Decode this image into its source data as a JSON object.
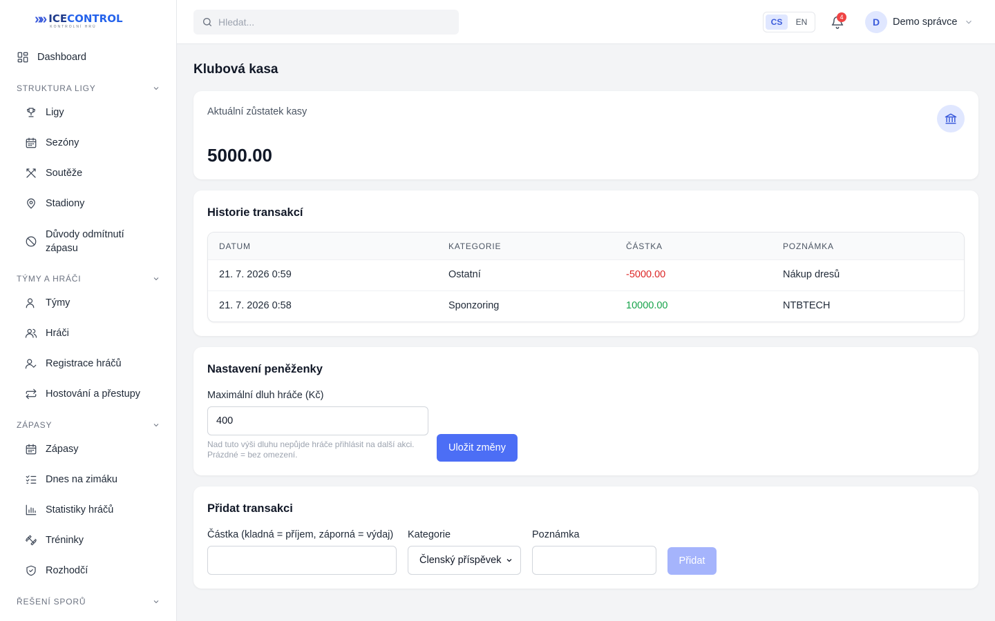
{
  "brand": {
    "logo_main_1": "ICE",
    "logo_main_2": "CONTROL",
    "logo_sub": "KONTROLNÍ HRÚ"
  },
  "sidebar": {
    "dashboard": "Dashboard",
    "sections": [
      {
        "title": "STRUKTURA LIGY",
        "items": [
          "Ligy",
          "Sezóny",
          "Soutěže",
          "Stadiony",
          "Důvody odmítnutí zápasu"
        ]
      },
      {
        "title": "TÝMY A HRÁČI",
        "items": [
          "Týmy",
          "Hráči",
          "Registrace hráčů",
          "Hostování a přestupy"
        ]
      },
      {
        "title": "ZÁPASY",
        "items": [
          "Zápasy",
          "Dnes na zimáku",
          "Statistiky hráčů",
          "Tréninky",
          "Rozhodčí"
        ]
      },
      {
        "title": "ŘEŠENÍ SPORŮ",
        "items": []
      }
    ]
  },
  "header": {
    "search_placeholder": "Hledat...",
    "languages": [
      "CS",
      "EN"
    ],
    "active_language": "CS",
    "notification_count": "4",
    "user_initial": "D",
    "user_name": "Demo správce"
  },
  "page": {
    "title": "Klubová kasa",
    "balance_label": "Aktuální zůstatek kasy",
    "balance_value": "5000.00",
    "history": {
      "title": "Historie transakcí",
      "columns": [
        "DATUM",
        "KATEGORIE",
        "ČÁSTKA",
        "POZNÁMKA"
      ],
      "rows": [
        {
          "date": "21. 7. 2026 0:59",
          "category": "Ostatní",
          "amount": "-5000.00",
          "note": "Nákup dresů"
        },
        {
          "date": "21. 7. 2026 0:58",
          "category": "Sponzoring",
          "amount": "10000.00",
          "note": "NTBTECH"
        }
      ]
    },
    "wallet": {
      "title": "Nastavení peněženky",
      "max_debt_label": "Maximální dluh hráče (Kč)",
      "max_debt_value": "400",
      "help_1": "Nad tuto výši dluhu nepůjde hráče přihlásit na další akci.",
      "help_2": "Prázdné = bez omezení.",
      "save_label": "Uložit změny"
    },
    "add_transaction": {
      "title": "Přidat transakci",
      "amount_label": "Částka (kladná = příjem, záporná = výdaj)",
      "amount_value": "",
      "category_label": "Kategorie",
      "category_selected": "Členský příspěvek",
      "note_label": "Poznámka",
      "note_value": "",
      "add_label": "Přidat"
    }
  },
  "colors": {
    "accent": "#4c6ef5",
    "negative": "#dc2626",
    "positive": "#16a34a"
  }
}
